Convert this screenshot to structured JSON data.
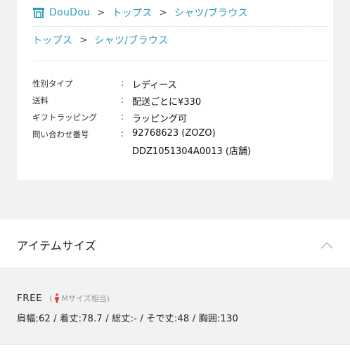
{
  "breadcrumbs": {
    "shop": {
      "label": "DouDou",
      "icon": "shop-icon"
    },
    "row1": [
      "トップス",
      "シャツ/ブラウス"
    ],
    "row2": [
      "トップス",
      "シャツ/ブラウス"
    ],
    "separator": ">"
  },
  "specs": [
    {
      "label": "性別タイプ",
      "value": "レディース"
    },
    {
      "label": "送料",
      "value": "配送ごとに¥330"
    },
    {
      "label": "ギフトラッピング",
      "value": "ラッピング可"
    },
    {
      "label": "問い合わせ番号",
      "value": "92768623 (ZOZO)",
      "value2": "DDZ1051304A0013 (店舗)"
    }
  ],
  "spec_colon": ":",
  "item_size": {
    "title": "アイテムサイズ",
    "toggle_icon": "chevron-up-icon",
    "size_name": "FREE",
    "hint_open": "(",
    "hint_text": "Mサイズ相当)",
    "hint_icon": "person-icon",
    "measurements": "肩幅:62 / 着丈:78.7 / 総丈:- / そで丈:48 / 胸囲:130"
  },
  "colors": {
    "link": "#2f9fb8",
    "hint": "#999999",
    "person_icon": "#e0403c",
    "background": "#f2f2f2"
  }
}
